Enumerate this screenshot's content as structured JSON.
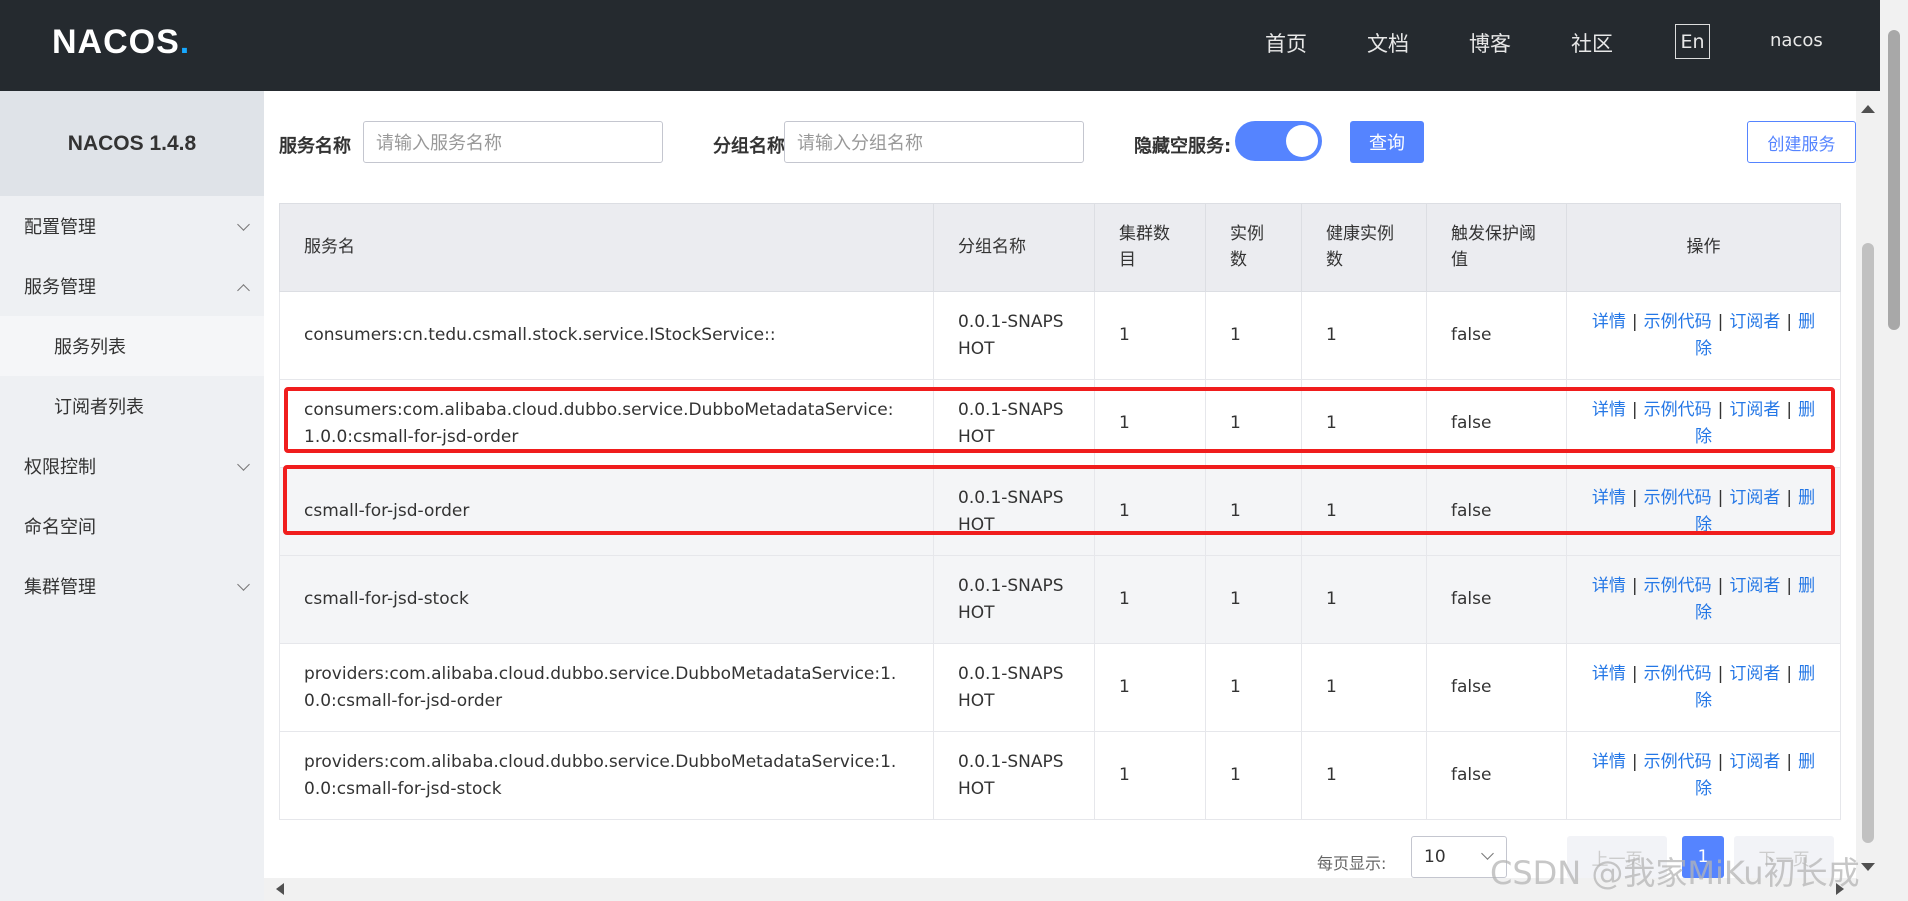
{
  "header": {
    "logo": "NACOS",
    "logo_dot": ".",
    "nav": [
      "首页",
      "文档",
      "博客",
      "社区"
    ],
    "lang": "En",
    "user": "nacos"
  },
  "sidebar": {
    "title": "NACOS 1.4.8",
    "items": [
      {
        "label": "配置管理"
      },
      {
        "label": "服务管理"
      },
      {
        "label": "服务列表"
      },
      {
        "label": "订阅者列表"
      },
      {
        "label": "权限控制"
      },
      {
        "label": "命名空间"
      },
      {
        "label": "集群管理"
      }
    ]
  },
  "filter": {
    "service_label": "服务名称",
    "service_placeholder": "请输入服务名称",
    "group_label": "分组名称",
    "group_placeholder": "请输入分组名称",
    "hide_empty_label": "隐藏空服务:",
    "hide_empty_on": true,
    "query_button": "查询",
    "create_button": "创建服务"
  },
  "table": {
    "headers": [
      "服务名",
      "分组名称",
      "集群数目",
      "实例数",
      "健康实例数",
      "触发保护阈值",
      "操作"
    ],
    "actions": {
      "detail": "详情",
      "sample": "示例代码",
      "subscribe": "订阅者",
      "delete": "删除",
      "sep": "|"
    },
    "rows": [
      {
        "name": "consumers:cn.tedu.csmall.stock.service.IStockService::",
        "group": "0.0.1-SNAPSHOT",
        "clusters": "1",
        "instances": "1",
        "healthy": "1",
        "threshold": "false"
      },
      {
        "name": "consumers:com.alibaba.cloud.dubbo.service.DubboMetadataService:1.0.0:csmall-for-jsd-order",
        "group": "0.0.1-SNAPSHOT",
        "clusters": "1",
        "instances": "1",
        "healthy": "1",
        "threshold": "false"
      },
      {
        "name": "csmall-for-jsd-order",
        "group": "0.0.1-SNAPSHOT",
        "clusters": "1",
        "instances": "1",
        "healthy": "1",
        "threshold": "false"
      },
      {
        "name": "csmall-for-jsd-stock",
        "group": "0.0.1-SNAPSHOT",
        "clusters": "1",
        "instances": "1",
        "healthy": "1",
        "threshold": "false"
      },
      {
        "name": "providers:com.alibaba.cloud.dubbo.service.DubboMetadataService:1.0.0:csmall-for-jsd-order",
        "group": "0.0.1-SNAPSHOT",
        "clusters": "1",
        "instances": "1",
        "healthy": "1",
        "threshold": "false"
      },
      {
        "name": "providers:com.alibaba.cloud.dubbo.service.DubboMetadataService:1.0.0:csmall-for-jsd-stock",
        "group": "0.0.1-SNAPSHOT",
        "clusters": "1",
        "instances": "1",
        "healthy": "1",
        "threshold": "false"
      }
    ]
  },
  "pagination": {
    "per_page_label": "每页显示:",
    "per_page": "10",
    "prev": "上一页",
    "current": "1",
    "next": "下一页"
  },
  "watermark": "CSDN @我家MiKu初长成",
  "colors": {
    "primary": "#5584ff",
    "link": "#2477e6",
    "highlight": "#f01d1d",
    "topbar": "#252a2f"
  }
}
